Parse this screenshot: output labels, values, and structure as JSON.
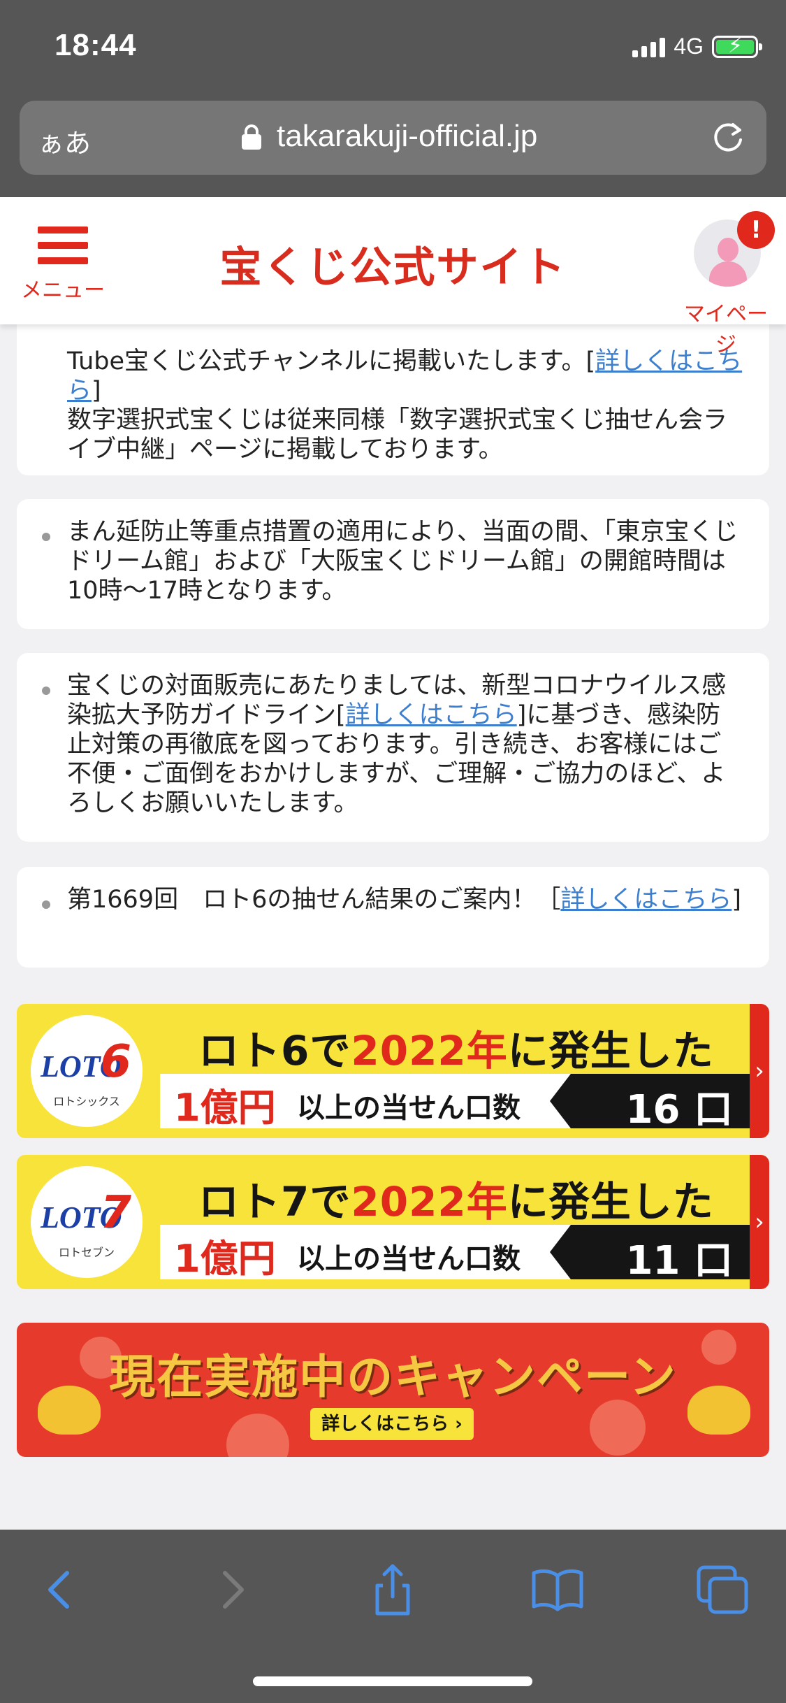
{
  "status_bar": {
    "time": "18:44",
    "network": "4G"
  },
  "browser": {
    "aa_label": "ぁあ",
    "url": "takarakuji-official.jp"
  },
  "header": {
    "menu_label": "メニュー",
    "logo_text": "宝くじ公式サイト",
    "mypage_label": "マイページ",
    "notification_badge": "!"
  },
  "notices": [
    {
      "lead": "Tube宝くじ公式チャンネルに掲載いたします。[",
      "link": "詳しくはこちら",
      "trail": "]",
      "extra": "数字選択式宝くじは従来同様「数字選択式宝くじ抽せん会ライブ中継」ページに掲載しております。"
    },
    {
      "text": "まん延防止等重点措置の適用により、当面の間、「東京宝くじドリーム館」および「大阪宝くじドリーム館」の開館時間は10時〜17時となります。"
    },
    {
      "lead": "宝くじの対面販売にあたりましては、新型コロナウイルス感染拡大予防ガイドライン[",
      "link": "詳しくはこちら",
      "trail": "]に基づき、感染防止対策の再徹底を図っております。引き続き、お客様にはご不便・ご面倒をおかけしますが、ご理解・ご協力のほど、よろしくお願いいたします。"
    },
    {
      "lead": "第1669回　ロト6の抽せん結果のご案内！［",
      "link": "詳しくはこちら",
      "trail": "]"
    }
  ],
  "banners": [
    {
      "logo_text": "LOTO",
      "logo_num": "6",
      "logo_sub": "ロトシックス",
      "headline_a": "ロト6で",
      "headline_year": "2022年",
      "headline_b": "に発生した",
      "strip_a": "1億円",
      "strip_b": "以上の当せん口数",
      "count": "16 口"
    },
    {
      "logo_text": "LOTO",
      "logo_num": "7",
      "logo_sub": "ロトセブン",
      "headline_a": "ロト7で",
      "headline_year": "2022年",
      "headline_b": "に発生した",
      "strip_a": "1億円",
      "strip_b": "以上の当せん口数",
      "count": "11 口"
    }
  ],
  "campaign": {
    "title": "現在実施中のキャンペーン",
    "button": "詳しくはこちら ›"
  },
  "toolbar": {
    "back": "back-icon",
    "forward": "forward-icon",
    "share": "share-icon",
    "bookmarks": "book-icon",
    "tabs": "tabs-icon"
  },
  "colors": {
    "brand_red": "#e0281c",
    "link_blue": "#3d7fcf",
    "banner_yellow": "#f7e33a",
    "chrome_gray": "#565656"
  }
}
